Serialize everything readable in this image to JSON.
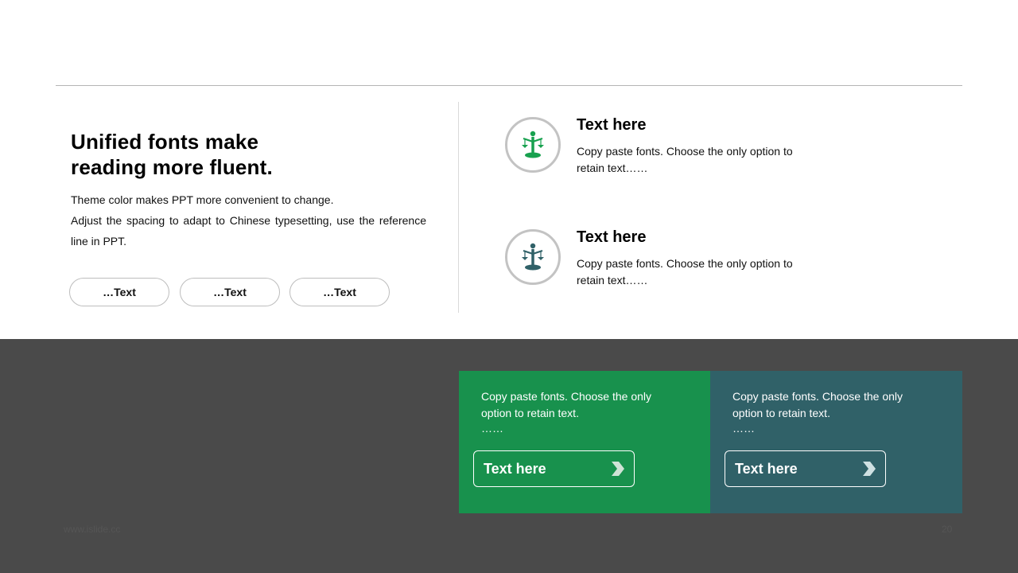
{
  "left": {
    "headline_line1": "Unified fonts make",
    "headline_line2": "reading more fluent.",
    "body_line1": "Theme color makes PPT more convenient  to change.",
    "body_line2": "Adjust the spacing to adapt to Chinese typesetting, use the reference",
    "body_line3": "line  in  PPT.",
    "pills": [
      "…Text",
      "…Text",
      "…Text"
    ]
  },
  "features": [
    {
      "title": "Text here",
      "desc": "Copy paste fonts. Choose the only option to retain text……",
      "icon": "justice-scales-icon",
      "color": "#18a14f"
    },
    {
      "title": "Text here",
      "desc": "Copy paste fonts. Choose the only option to retain text……",
      "icon": "justice-scales-icon",
      "color": "#306168"
    }
  ],
  "panels": [
    {
      "text": "Copy paste fonts. Choose the only option to retain text.",
      "ellipsis": "……",
      "button_label": "Text here",
      "color": "#18914d"
    },
    {
      "text": "Copy paste fonts. Choose the only option to retain text.",
      "ellipsis": "……",
      "button_label": "Text here",
      "color": "#306168"
    }
  ],
  "footer": {
    "url": "www.islide.cc",
    "page": "20"
  }
}
